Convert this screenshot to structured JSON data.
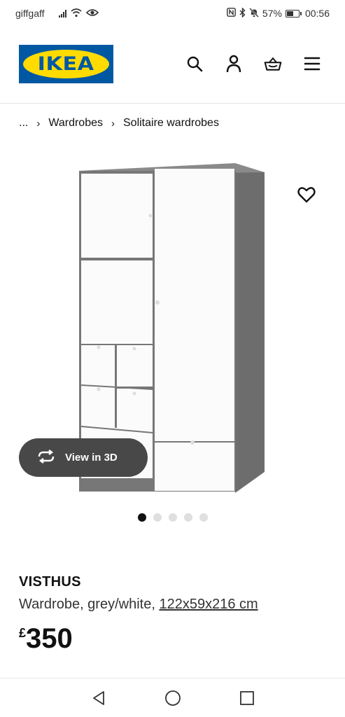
{
  "status_bar": {
    "carrier": "giffgaff",
    "battery_percent": "57%",
    "battery_level": 0.57,
    "time": "00:56",
    "icons": [
      "signal-icon",
      "wifi-icon",
      "eye-icon",
      "nfc-icon",
      "bluetooth-icon",
      "mute-bell-icon",
      "battery-icon"
    ]
  },
  "header": {
    "logo_text": "IKEA",
    "icons": [
      "search-icon",
      "account-icon",
      "basket-icon",
      "menu-icon"
    ],
    "brand_colors": {
      "blue": "#0058a3",
      "yellow": "#ffdb00"
    }
  },
  "breadcrumb": {
    "ellipsis": "...",
    "items": [
      "Wardrobes",
      "Solitaire wardrobes"
    ]
  },
  "gallery": {
    "favourite_icon": "heart-icon",
    "view_3d_label": "View in 3D",
    "image_count": 5,
    "active_index": 0
  },
  "product": {
    "name": "VISTHUS",
    "description": "Wardrobe, grey/white, ",
    "dimensions": "122x59x216 cm",
    "currency": "£",
    "price": "350"
  },
  "nav": {
    "icons": [
      "back-icon",
      "home-icon",
      "recents-icon"
    ]
  }
}
